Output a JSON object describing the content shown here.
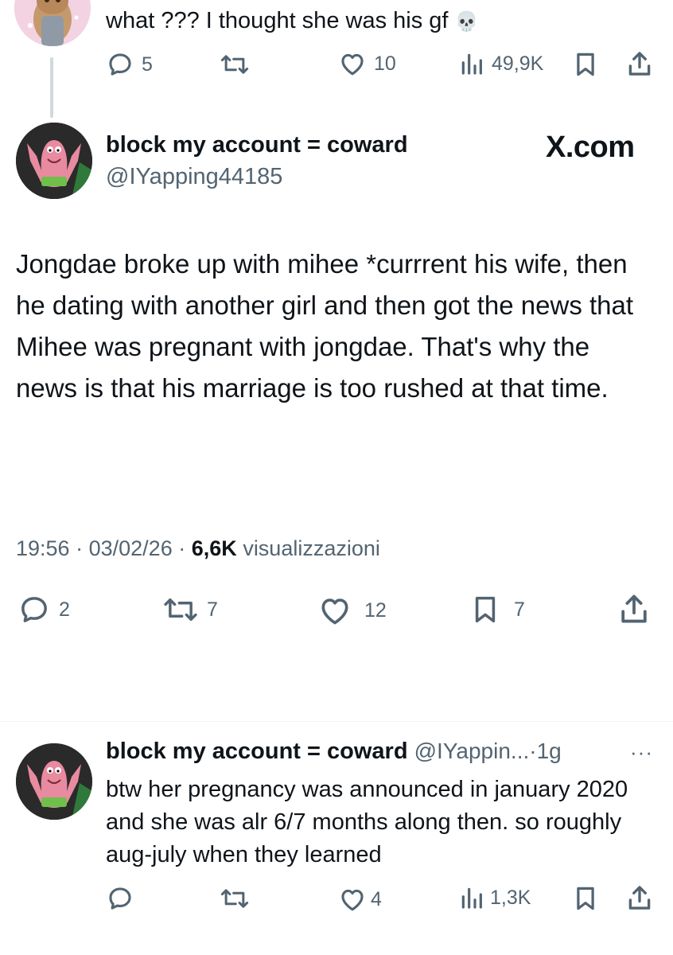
{
  "previous_tweet": {
    "text": "what ??? I thought she was his gf",
    "emoji": "💀",
    "actions": {
      "replies": "5",
      "retweets": "",
      "likes": "10",
      "views": "49,9K"
    }
  },
  "main_tweet": {
    "display_name": "block my account = coward",
    "handle": "@IYapping44185",
    "watermark": "X.com",
    "text": "Jongdae broke up with mihee *currrent his wife, then he dating with another girl and then got the news that Mihee was pregnant with jongdae. That's why the news is that his marriage is too rushed at that time.",
    "time": "19:56",
    "separator": "·",
    "date": "03/02/26",
    "views_count": "6,6K",
    "views_label": "visualizzazioni",
    "actions": {
      "replies": "2",
      "retweets": "7",
      "likes": "12",
      "bookmarks": "7"
    }
  },
  "reply_tweet": {
    "display_name": "block my account = coward",
    "handle_short": "@IYappin...",
    "separator": "·",
    "time_ago": "1g",
    "more_label": "···",
    "text": "btw her pregnancy was announced in january 2020 and she was alr 6/7 months along then. so roughly aug-july when they learned",
    "actions": {
      "replies": "",
      "retweets": "",
      "likes": "4",
      "views": "1,3K"
    }
  },
  "colors": {
    "text_primary": "#0f1419",
    "text_secondary": "#536471",
    "thread_line": "#cfd9de",
    "avatar_patrick_bg": "#2a2a2a",
    "avatar_cat_bg": "#f3d3e2"
  }
}
